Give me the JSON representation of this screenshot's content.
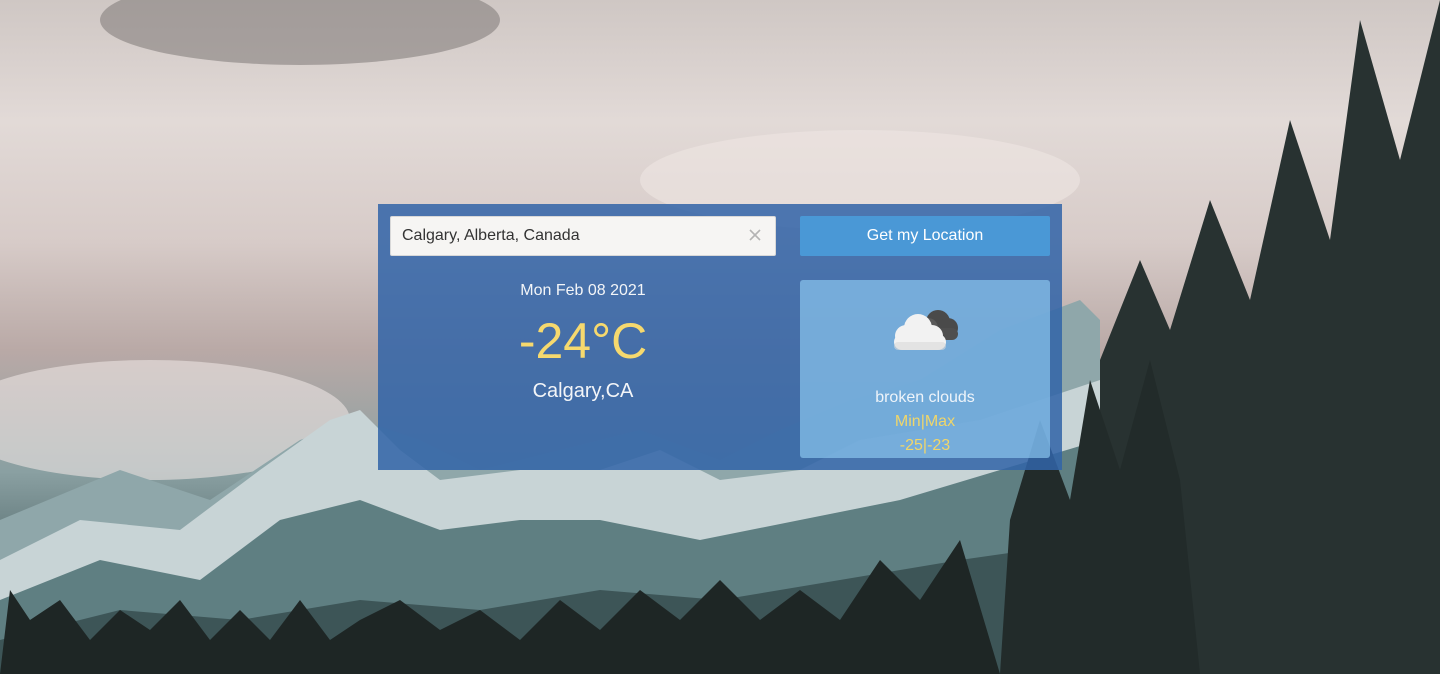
{
  "search": {
    "value": "Calgary, Alberta, Canada",
    "clear_icon": "close-icon"
  },
  "location_button": {
    "label": "Get my Location"
  },
  "weather": {
    "date": "Mon Feb 08 2021",
    "temperature": "-24°C",
    "city": "Calgary,CA",
    "condition_icon": "broken-clouds-icon",
    "description": "broken clouds",
    "minmax_label": "Min|Max",
    "minmax_value": "-25|-23"
  },
  "colors": {
    "panel": "#3264a8",
    "accent_yellow": "#f6d96e",
    "button_blue": "#4a98d6",
    "card_blue": "#8cc8f0"
  }
}
